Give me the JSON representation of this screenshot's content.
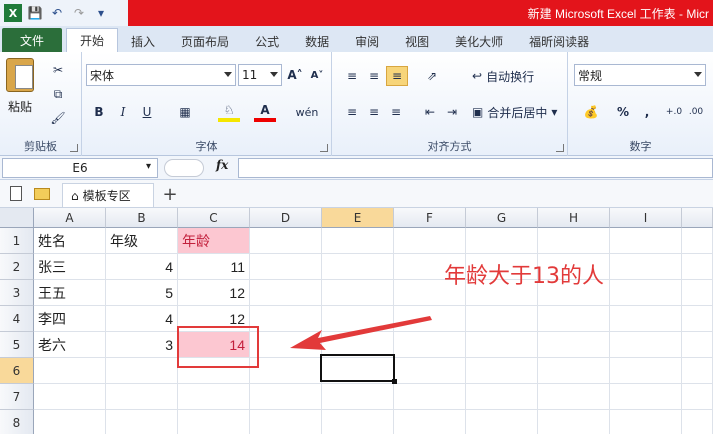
{
  "window": {
    "title": "新建 Microsoft Excel 工作表 - Micr"
  },
  "qat": {
    "items": [
      "excel-icon",
      "save-icon",
      "undo-icon",
      "redo-icon",
      "customize-icon"
    ]
  },
  "tabs": [
    "文件",
    "开始",
    "插入",
    "页面布局",
    "公式",
    "数据",
    "审阅",
    "视图",
    "美化大师",
    "福昕阅读器"
  ],
  "ribbon": {
    "clipboard": {
      "label": "剪贴板",
      "paste": "粘贴"
    },
    "font": {
      "label": "字体",
      "font_name": "宋体",
      "font_size": "11",
      "bold": "B",
      "italic": "I",
      "underline": "U"
    },
    "alignment": {
      "label": "对齐方式",
      "wrap": "自动换行",
      "merge": "合并后居中"
    },
    "number": {
      "label": "数字",
      "format": "常规",
      "percent": "%"
    }
  },
  "formula_bar": {
    "name_box": "E6",
    "fx": "fx",
    "value": ""
  },
  "doc_tabs": {
    "active": "模板专区",
    "add": "+"
  },
  "sheet": {
    "columns": [
      "A",
      "B",
      "C",
      "D",
      "E",
      "F",
      "G",
      "H",
      "I"
    ],
    "rows": [
      "1",
      "2",
      "3",
      "4",
      "5",
      "6",
      "7",
      "8"
    ],
    "data": [
      [
        "姓名",
        "年级",
        "年龄"
      ],
      [
        "张三",
        "4",
        "11"
      ],
      [
        "王五",
        "5",
        "12"
      ],
      [
        "李四",
        "4",
        "12"
      ],
      [
        "老六",
        "3",
        "14"
      ]
    ]
  },
  "annotation": {
    "text": "年龄大于13的人"
  },
  "colors": {
    "accent_red": "#e23a3a",
    "highlight_pink": "#fcc7d1",
    "file_tab_green": "#2b6e3a"
  }
}
